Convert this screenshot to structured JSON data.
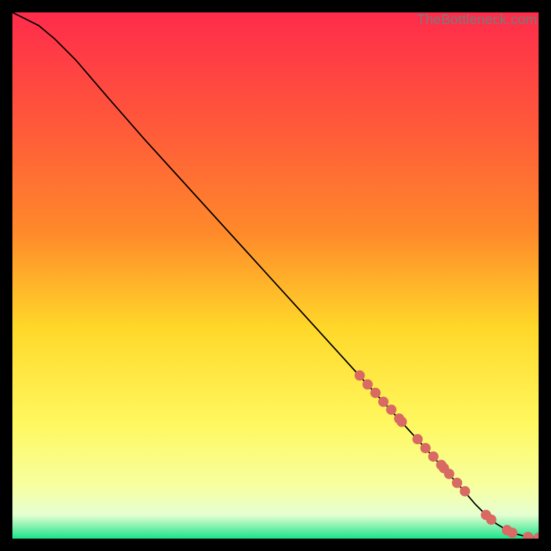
{
  "watermark": "TheBottleneck.com",
  "colors": {
    "gradient_top": "#ff2b4b",
    "gradient_mid1": "#ff8a2a",
    "gradient_mid2": "#ffd829",
    "gradient_mid3": "#fff85f",
    "gradient_mid4": "#f7ffa0",
    "gradient_bottom_pale": "#e6ffd1",
    "gradient_bottom_green": "#19e48a",
    "curve": "#000000",
    "marker_fill": "#d86a63",
    "marker_stroke": "#c2544e",
    "frame_bg": "#000000"
  },
  "chart_data": {
    "type": "line",
    "title": "",
    "xlabel": "",
    "ylabel": "",
    "xlim": [
      0,
      100
    ],
    "ylim": [
      0,
      100
    ],
    "series": [
      {
        "name": "curve",
        "x": [
          0,
          2,
          5,
          8,
          12,
          18,
          25,
          35,
          45,
          55,
          65,
          75,
          85,
          88,
          90,
          92,
          94,
          96,
          98,
          100
        ],
        "y": [
          100,
          99,
          97.5,
          95,
          91,
          84,
          76,
          65,
          54,
          43,
          32,
          21,
          10,
          6.5,
          4.5,
          2.8,
          1.6,
          0.8,
          0.3,
          0.15
        ]
      }
    ],
    "markers": {
      "name": "highlight-points",
      "x": [
        66,
        67.5,
        69,
        70.5,
        72,
        73.5,
        74,
        77,
        78.5,
        80,
        81.5,
        82,
        83,
        84.5,
        86,
        90,
        91,
        94,
        95,
        98,
        100
      ],
      "y": [
        31,
        29.3,
        27.7,
        26,
        24.5,
        22.8,
        22.2,
        18.9,
        17.2,
        15.6,
        14,
        13.4,
        12.3,
        10.6,
        9,
        4.5,
        3.6,
        1.6,
        1.1,
        0.3,
        0.15
      ]
    },
    "gradient_bands": [
      {
        "stop": 0.0,
        "color": "#ff2b4b"
      },
      {
        "stop": 0.22,
        "color": "#ff5a3a"
      },
      {
        "stop": 0.42,
        "color": "#ff8a2a"
      },
      {
        "stop": 0.6,
        "color": "#ffd829"
      },
      {
        "stop": 0.78,
        "color": "#fff85f"
      },
      {
        "stop": 0.9,
        "color": "#f7ffa0"
      },
      {
        "stop": 0.955,
        "color": "#e6ffd1"
      },
      {
        "stop": 0.975,
        "color": "#8df2b2"
      },
      {
        "stop": 1.0,
        "color": "#19e48a"
      }
    ]
  }
}
